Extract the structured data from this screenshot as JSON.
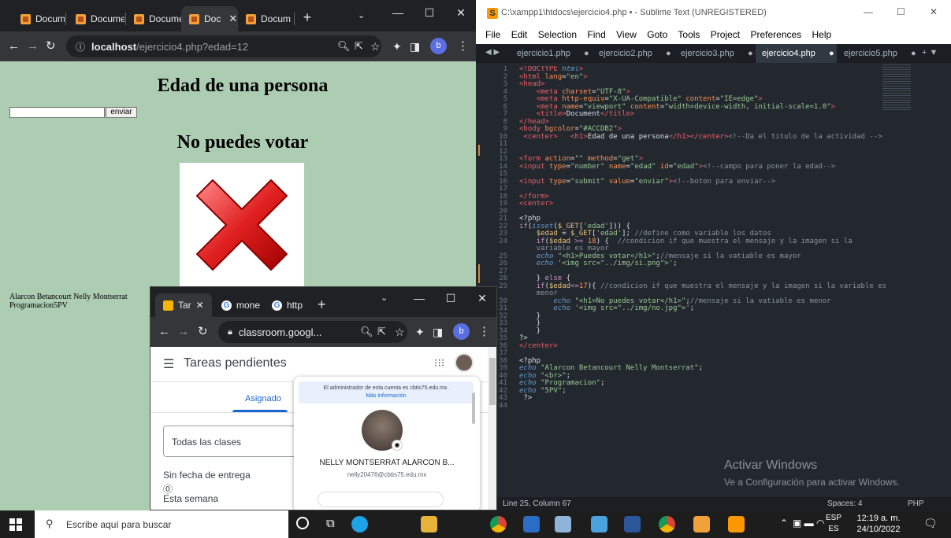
{
  "chrome_left": {
    "tabs": [
      "Docume",
      "Docume",
      "Docume",
      "Doc",
      "Docum"
    ],
    "url_host": "localhost",
    "url_path": "/ejercicio4.php?edad=12",
    "profile_initial": "b",
    "page": {
      "title": "Edad de una persona",
      "button": "enviar",
      "message": "No puedes votar",
      "footer_line1": "Alarcon Betancourt Nelly Montserrat",
      "footer_line2": "Programacion5PV"
    }
  },
  "sublime": {
    "title": "C:\\xampp1\\htdocs\\ejercicio4.php • - Sublime Text (UNREGISTERED)",
    "menu": [
      "File",
      "Edit",
      "Selection",
      "Find",
      "View",
      "Goto",
      "Tools",
      "Project",
      "Preferences",
      "Help"
    ],
    "tabs": [
      "ejercicio1.php",
      "ejercicio2.php",
      "ejercicio3.php",
      "ejercicio4.php",
      "ejercicio5.php"
    ],
    "status_left": "Line 25, Column 67",
    "status_spaces": "Spaces: 4",
    "status_syntax": "PHP",
    "watermark_1": "Activar Windows",
    "watermark_2": "Ve a Configuración para activar Windows."
  },
  "chrome_popup": {
    "tabs": [
      "Tar",
      "mone",
      "http"
    ],
    "url": "classroom.googl...",
    "app_title": "Tareas pendientes",
    "tab_assigned": "Asignado",
    "select_label": "Todas las clases",
    "section1": "Sin fecha de entrega",
    "section2": "Esta semana",
    "account_notice": "El administrador de esta cuenta es cbtis75.edu.mx.",
    "account_more": "Más información",
    "account_name": "NELLY MONTSERRAT ALARCON B...",
    "account_email": "nelly20476@cbtis75.edu.mx",
    "count": "0"
  },
  "taskbar": {
    "search": "Escribe aquí para buscar",
    "lang1": "ESP",
    "lang2": "ES",
    "time": "12:19 a. m.",
    "date": "24/10/2022"
  }
}
